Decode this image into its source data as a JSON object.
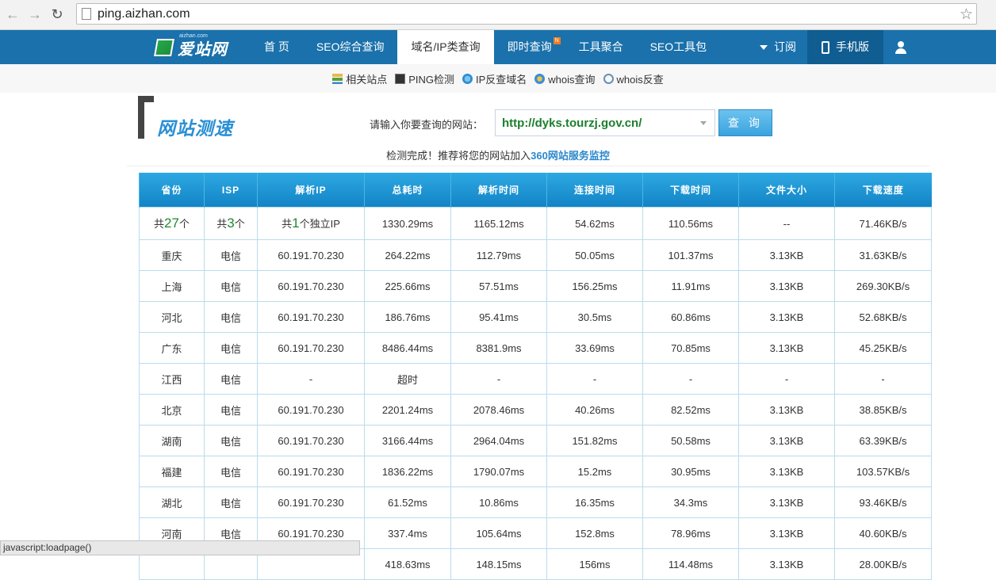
{
  "browser": {
    "url": "ping.aizhan.com",
    "status_text": "javascript:loadpage()"
  },
  "site": {
    "logo_text": "爱站网",
    "logo_sub": "aizhan.com",
    "nav": [
      {
        "label": "首 页",
        "active": false
      },
      {
        "label": "SEO综合查询",
        "active": false
      },
      {
        "label": "域名/IP类查询",
        "active": true
      },
      {
        "label": "即时查询",
        "active": false,
        "badge": "N"
      },
      {
        "label": "工具聚合",
        "active": false
      },
      {
        "label": "SEO工具包",
        "active": false
      }
    ],
    "subscribe_label": "订阅",
    "mobile_label": "手机版"
  },
  "subnav": [
    {
      "label": "相关站点",
      "icon": "list-icon"
    },
    {
      "label": "PING检测",
      "icon": "ping-icon"
    },
    {
      "label": "IP反查域名",
      "icon": "ip-icon"
    },
    {
      "label": "whois查询",
      "icon": "whois-icon"
    },
    {
      "label": "whois反查",
      "icon": "search-icon"
    }
  ],
  "page": {
    "title": "网站测速",
    "query_label": "请输入你要查询的网站：",
    "query_value": "http://dyks.tourzj.gov.cn/",
    "query_button": "查 询",
    "status_prefix": "检测完成！推荐将您的网站加入",
    "status_link": "360网站服务监控"
  },
  "table": {
    "headers": [
      "省份",
      "ISP",
      "解析IP",
      "总耗时",
      "解析时间",
      "连接时间",
      "下载时间",
      "文件大小",
      "下载速度"
    ],
    "summary": {
      "province_pre": "共",
      "province_count": "27",
      "province_post": "个",
      "isp_pre": "共",
      "isp_count": "3",
      "isp_post": "个",
      "ip_pre": "共",
      "ip_count": "1",
      "ip_post": "个独立IP",
      "total": "1330.29ms",
      "resolve": "1165.12ms",
      "connect": "54.62ms",
      "download": "110.56ms",
      "size": "--",
      "speed": "71.46KB/s"
    },
    "rows": [
      {
        "province": "重庆",
        "isp": "电信",
        "ip": "60.191.70.230",
        "total": "264.22ms",
        "total_color": "green",
        "resolve": "112.79ms",
        "connect": "50.05ms",
        "download": "101.37ms",
        "size": "3.13KB",
        "speed": "31.63KB/s",
        "speed_color": "orange"
      },
      {
        "province": "上海",
        "isp": "电信",
        "ip": "60.191.70.230",
        "total": "225.66ms",
        "total_color": "green",
        "resolve": "57.51ms",
        "connect": "156.25ms",
        "download": "11.91ms",
        "size": "3.13KB",
        "speed": "269.30KB/s",
        "speed_color": "normal"
      },
      {
        "province": "河北",
        "isp": "电信",
        "ip": "60.191.70.230",
        "total": "186.76ms",
        "total_color": "green",
        "resolve": "95.41ms",
        "connect": "30.5ms",
        "download": "60.86ms",
        "size": "3.13KB",
        "speed": "52.68KB/s",
        "speed_color": "green"
      },
      {
        "province": "广东",
        "isp": "电信",
        "ip": "60.191.70.230",
        "total": "8486.44ms",
        "total_color": "red",
        "resolve": "8381.9ms",
        "connect": "33.69ms",
        "download": "70.85ms",
        "size": "3.13KB",
        "speed": "45.25KB/s",
        "speed_color": "orange"
      },
      {
        "province": "江西",
        "isp": "电信",
        "ip": "-",
        "total": "超时",
        "total_color": "red",
        "resolve": "-",
        "connect": "-",
        "download": "-",
        "size": "-",
        "speed": "-",
        "speed_color": "normal"
      },
      {
        "province": "北京",
        "isp": "电信",
        "ip": "60.191.70.230",
        "total": "2201.24ms",
        "total_color": "red",
        "resolve": "2078.46ms",
        "connect": "40.26ms",
        "download": "82.52ms",
        "size": "3.13KB",
        "speed": "38.85KB/s",
        "speed_color": "orange"
      },
      {
        "province": "湖南",
        "isp": "电信",
        "ip": "60.191.70.230",
        "total": "3166.44ms",
        "total_color": "red",
        "resolve": "2964.04ms",
        "connect": "151.82ms",
        "download": "50.58ms",
        "size": "3.13KB",
        "speed": "63.39KB/s",
        "speed_color": "green"
      },
      {
        "province": "福建",
        "isp": "电信",
        "ip": "60.191.70.230",
        "total": "1836.22ms",
        "total_color": "orange",
        "resolve": "1790.07ms",
        "connect": "15.2ms",
        "download": "30.95ms",
        "size": "3.13KB",
        "speed": "103.57KB/s",
        "speed_color": "lime"
      },
      {
        "province": "湖北",
        "isp": "电信",
        "ip": "60.191.70.230",
        "total": "61.52ms",
        "total_color": "green",
        "resolve": "10.86ms",
        "connect": "16.35ms",
        "download": "34.3ms",
        "size": "3.13KB",
        "speed": "93.46KB/s",
        "speed_color": "green"
      },
      {
        "province": "河南",
        "isp": "电信",
        "ip": "60.191.70.230",
        "total": "337.4ms",
        "total_color": "green",
        "resolve": "105.64ms",
        "connect": "152.8ms",
        "download": "78.96ms",
        "size": "3.13KB",
        "speed": "40.60KB/s",
        "speed_color": "orange"
      },
      {
        "province": "",
        "isp": "",
        "ip": "",
        "total": "418.63ms",
        "total_color": "green",
        "resolve": "148.15ms",
        "connect": "156ms",
        "download": "114.48ms",
        "size": "3.13KB",
        "speed": "28.00KB/s",
        "speed_color": "orange"
      }
    ]
  },
  "colors": {
    "nav_bg": "#1a71ab",
    "header_bg": "#1384c6",
    "green": "#1b8a2a",
    "red": "#d62d2d",
    "orange": "#f07d22",
    "lime": "#21b82c"
  }
}
